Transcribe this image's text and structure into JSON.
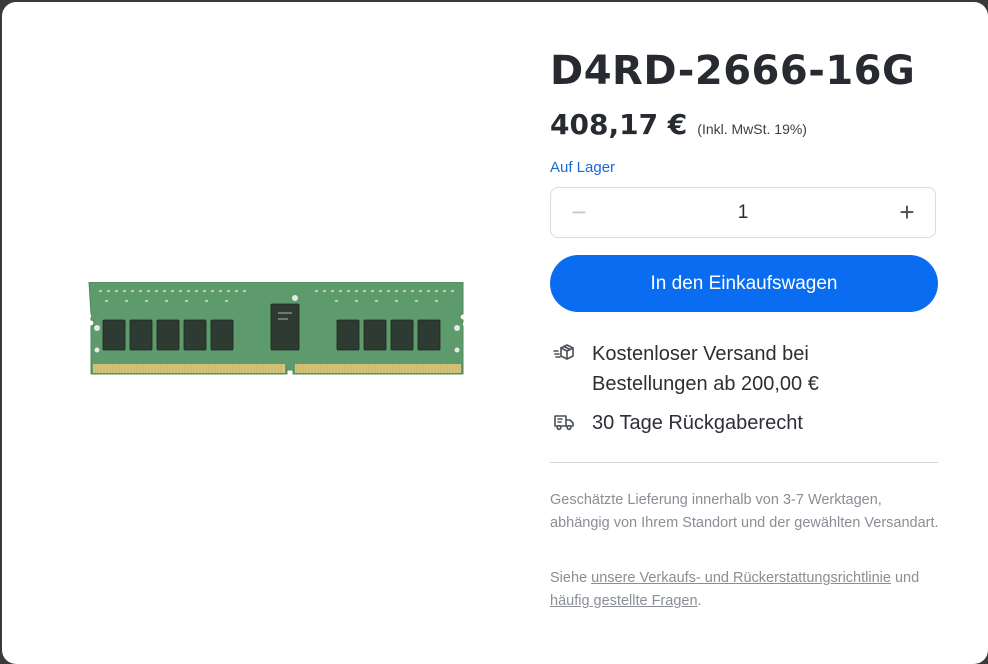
{
  "product": {
    "title": "D4RD-2666-16G",
    "price": "408,17 €",
    "tax_note": "(Inkl. MwSt. 19%)",
    "stock_status": "Auf Lager",
    "image_alt": "DDR4 ECC RDIMM memory module",
    "colors": {
      "accent": "#0a6cf0",
      "stock": "#1769d8",
      "pcb": "#5a9a6a"
    }
  },
  "quantity": {
    "value": "1",
    "minus_symbol": "−",
    "plus_symbol": "+"
  },
  "cart": {
    "button_label": "In den Einkaufswagen"
  },
  "features": [
    {
      "icon": "box-icon",
      "text": "Kostenloser Versand bei Bestellungen ab 200,00 €"
    },
    {
      "icon": "truck-icon",
      "text": "30 Tage Rückgaberecht"
    }
  ],
  "notes": {
    "delivery": "Geschätzte Lieferung innerhalb von 3-7 Werktagen, abhängig von Ihrem Standort und der gewählten Versandart.",
    "policy_prefix": "Siehe ",
    "policy_link": "unsere Verkaufs- und Rückerstattungsrichtlinie",
    "policy_middle": " und ",
    "faq_link": "häufig gestellte Fragen",
    "policy_suffix": "."
  }
}
